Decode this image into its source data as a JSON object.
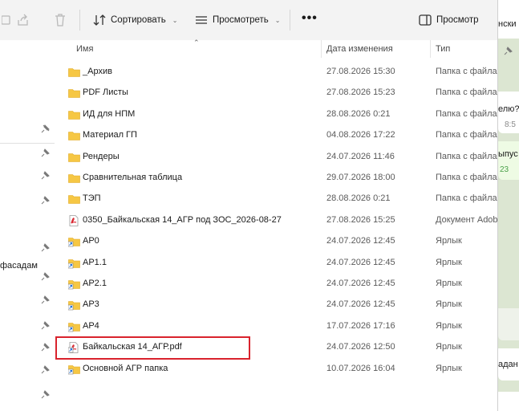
{
  "toolbar": {
    "sort_label": "Сортировать",
    "view_label": "Просмотреть",
    "more_label": "•••",
    "preview_label": "Просмотр"
  },
  "nav": {
    "partial_label": "фасадам"
  },
  "columns": {
    "name": "Имя",
    "date": "Дата изменения",
    "type": "Тип"
  },
  "files": [
    {
      "name": "_Архив",
      "date": "27.08.2026 15:30",
      "type": "Папка с файлами",
      "icon": "folder"
    },
    {
      "name": "PDF Листы",
      "date": "27.08.2026 15:23",
      "type": "Папка с файлами",
      "icon": "folder"
    },
    {
      "name": "ИД для НПМ",
      "date": "28.08.2026 0:21",
      "type": "Папка с файлами",
      "icon": "folder"
    },
    {
      "name": "Материал ГП",
      "date": "04.08.2026 17:22",
      "type": "Папка с файлами",
      "icon": "folder"
    },
    {
      "name": "Рендеры",
      "date": "24.07.2026 11:46",
      "type": "Папка с файлами",
      "icon": "folder"
    },
    {
      "name": "Сравнительная таблица",
      "date": "29.07.2026 18:00",
      "type": "Папка с файлами",
      "icon": "folder"
    },
    {
      "name": "ТЭП",
      "date": "28.08.2026 0:21",
      "type": "Папка с файлами",
      "icon": "folder"
    },
    {
      "name": "0350_Байкальская 14_АГР под ЗОС_2026-08-27",
      "date": "27.08.2026 15:25",
      "type": "Документ Adobe",
      "icon": "pdf"
    },
    {
      "name": "АР0",
      "date": "24.07.2026 12:45",
      "type": "Ярлык",
      "icon": "shortcut"
    },
    {
      "name": "АР1.1",
      "date": "24.07.2026 12:45",
      "type": "Ярлык",
      "icon": "shortcut"
    },
    {
      "name": "АР2.1",
      "date": "24.07.2026 12:45",
      "type": "Ярлык",
      "icon": "shortcut"
    },
    {
      "name": "АР3",
      "date": "24.07.2026 12:45",
      "type": "Ярлык",
      "icon": "shortcut"
    },
    {
      "name": "АР4",
      "date": "17.07.2026 17:16",
      "type": "Ярлык",
      "icon": "shortcut"
    },
    {
      "name": "Байкальская 14_АГР.pdf",
      "date": "24.07.2026 12:50",
      "type": "Ярлык",
      "icon": "pdf-shortcut"
    },
    {
      "name": "Основной АГР папка",
      "date": "10.07.2026 16:04",
      "type": "Ярлык",
      "icon": "shortcut"
    }
  ],
  "side_app": {
    "title_fragment": "нски",
    "msg1": "елю?",
    "time1": "8:5",
    "msg2": "ыпус",
    "time2": "23",
    "msg3": "адан"
  },
  "colors": {
    "folder": "#f6c744",
    "pdf": "#d9232d",
    "highlight": "#d9232d",
    "shortcut_arrow": "#1f6fd6"
  }
}
